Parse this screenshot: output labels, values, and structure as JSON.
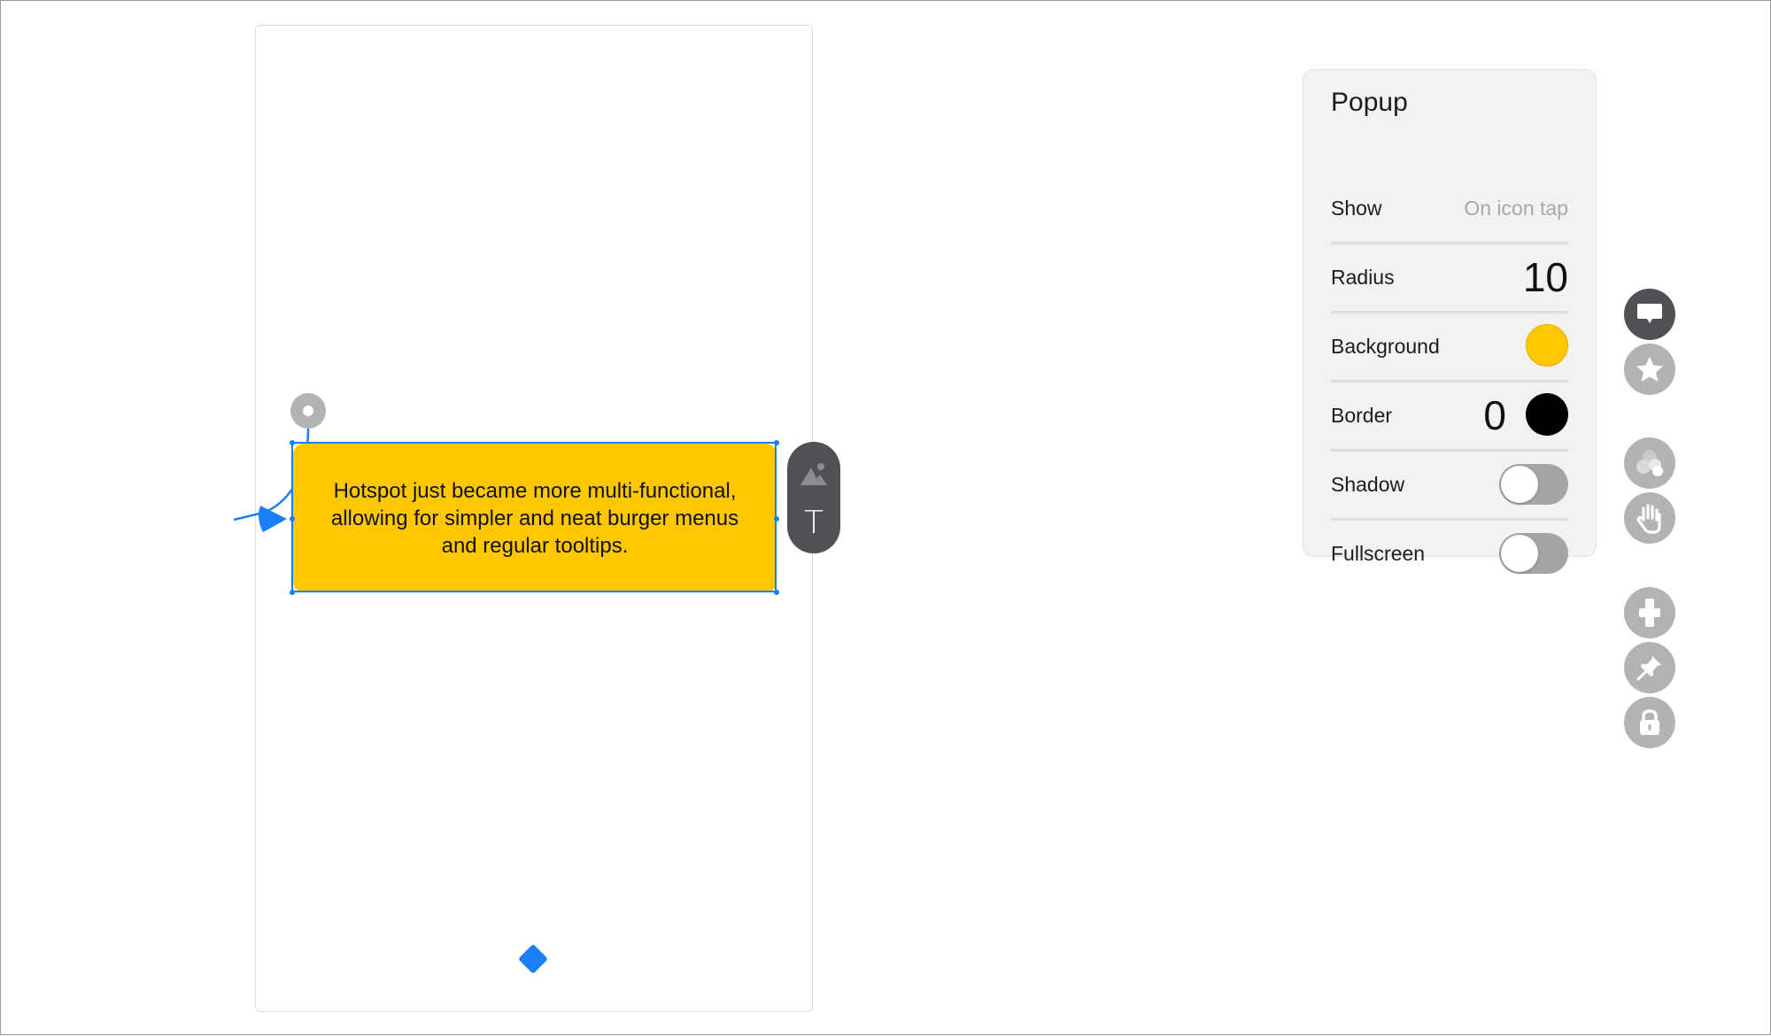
{
  "popup": {
    "text": "Hotspot just became more multi-functional, allowing for simpler and neat burger menus and regular tooltips.",
    "background_color": "#ffc700"
  },
  "side_pill": {
    "icons": [
      "image-icon",
      "text-icon"
    ],
    "text_glyph": "T"
  },
  "panel": {
    "title": "Popup",
    "rows": {
      "show": {
        "label": "Show",
        "value": "On icon tap"
      },
      "radius": {
        "label": "Radius",
        "value": "10"
      },
      "background": {
        "label": "Background",
        "color": "#ffc700"
      },
      "border": {
        "label": "Border",
        "value": "0",
        "color": "#000000"
      },
      "shadow": {
        "label": "Shadow",
        "on": false
      },
      "fullscreen": {
        "label": "Fullscreen",
        "on": false
      }
    }
  },
  "toolbar": {
    "buttons": [
      {
        "icon": "speech-bubble-icon",
        "active": true
      },
      {
        "icon": "star-icon",
        "active": false
      },
      {
        "icon": "circles-icon",
        "active": false
      },
      {
        "icon": "hand-icon",
        "active": false
      },
      {
        "icon": "plus-icon",
        "active": false
      },
      {
        "icon": "pin-icon",
        "active": false
      },
      {
        "icon": "lock-icon",
        "active": false
      }
    ]
  },
  "colors": {
    "accent": "#1a7ef5",
    "active_button": "#505055",
    "inactive_button": "#b3b3b3"
  }
}
